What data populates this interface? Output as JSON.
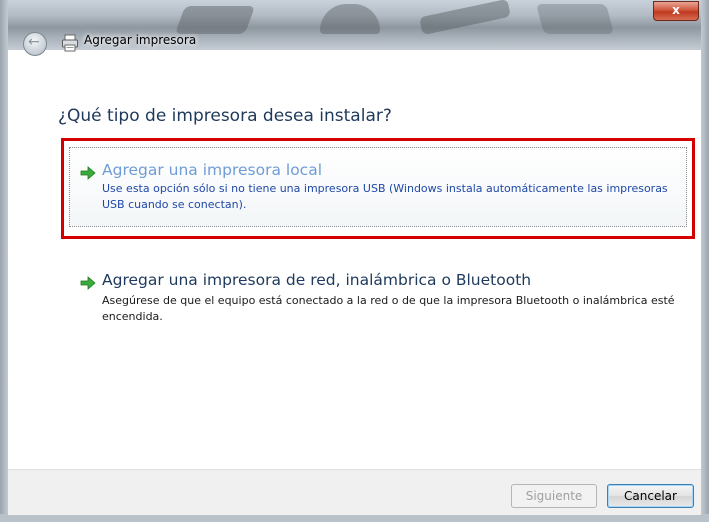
{
  "window": {
    "title": "Agregar impresora",
    "close_glyph": "x"
  },
  "page": {
    "heading": "¿Qué tipo de impresora desea instalar?"
  },
  "options": [
    {
      "title": "Agregar una impresora local",
      "description": "Use esta opción sólo si no tiene una impresora USB (Windows instala automáticamente las impresoras USB cuando se conectan).",
      "icon": "green-arrow-icon",
      "highlighted": true
    },
    {
      "title": "Agregar una impresora de red, inalámbrica o Bluetooth",
      "description": "Asegúrese de que el equipo está conectado a la red o de que la impresora Bluetooth o inalámbrica esté encendida.",
      "icon": "green-arrow-icon",
      "highlighted": false
    }
  ],
  "buttons": {
    "next": "Siguiente",
    "cancel": "Cancelar"
  },
  "colors": {
    "highlight_border": "#d40000",
    "link_blue": "#1f48a8",
    "heading_blue": "#1e395b"
  }
}
